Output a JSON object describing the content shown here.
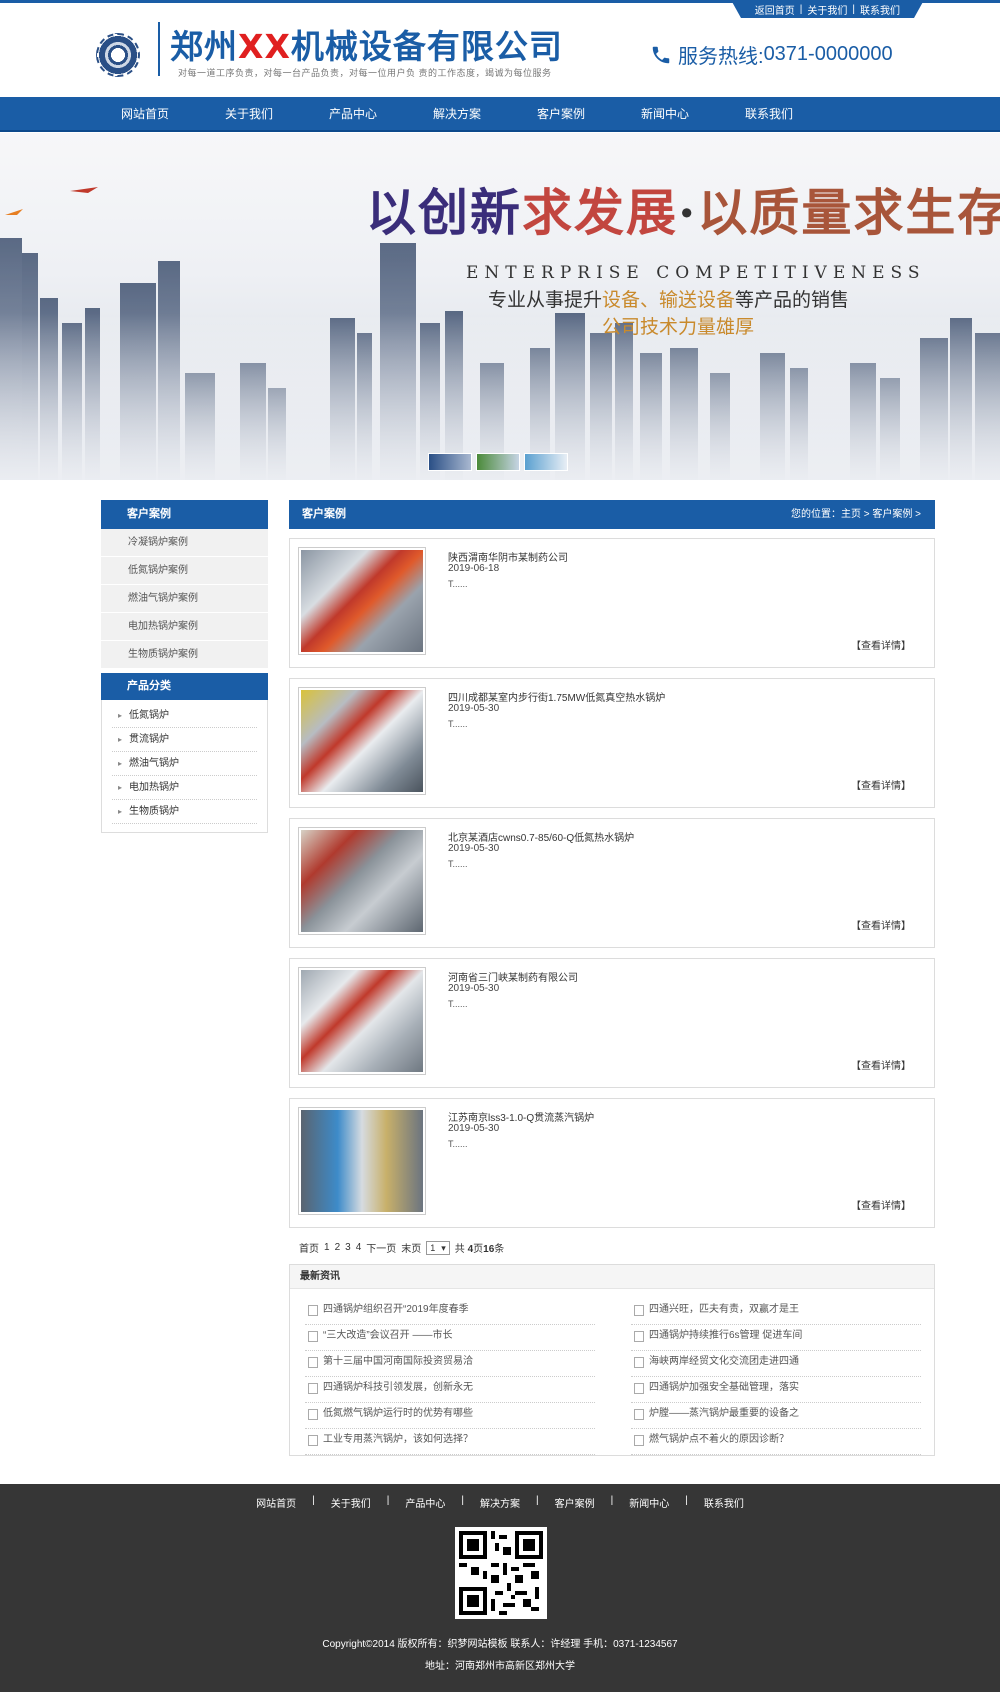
{
  "header": {
    "top_links": [
      "返回首页",
      "关于我们",
      "联系我们"
    ],
    "company_prefix": "郑州",
    "company_xx": "XX",
    "company_suffix": "机械设备有限公司",
    "slogan": "对每一道工序负责，对每一台产品负责，对每一位用户负 责的工作态度，竭诚为每位服务",
    "hotline_label": "服务热线:",
    "hotline_number": "0371-0000000"
  },
  "nav": [
    "网站首页",
    "关于我们",
    "产品中心",
    "解决方案",
    "客户案例",
    "新闻中心",
    "联系我们"
  ],
  "banner": {
    "title_part1": "以创新",
    "title_part2": "求发展",
    "title_dot": "·",
    "title_part3": "以质量求生存",
    "english": "ENTERPRISE COMPETITIVENESS",
    "sub1_a": "专业从事提升",
    "sub1_b": "设备、输送设备",
    "sub1_c": "等产品的销售",
    "sub2": "公司技术力量雄厚"
  },
  "sidebar": {
    "cases_title": "客户案例",
    "cases": [
      "冷凝锅炉案例",
      "低氮锅炉案例",
      "燃油气锅炉案例",
      "电加热锅炉案例",
      "生物质锅炉案例"
    ],
    "products_title": "产品分类",
    "products": [
      "低氮锅炉",
      "贯流锅炉",
      "燃油气锅炉",
      "电加热锅炉",
      "生物质锅炉"
    ]
  },
  "main": {
    "title": "客户案例",
    "breadcrumb": "您的位置：主页 > 客户案例 >",
    "more_label": "【查看详情】",
    "cases": [
      {
        "title": "陕西渭南华阴市某制药公司",
        "date": "2019-06-18",
        "desc": "T......"
      },
      {
        "title": "四川成都某室内步行街1.75MW低氮真空热水锅炉",
        "date": "2019-05-30",
        "desc": "T......"
      },
      {
        "title": "北京某酒店cwns0.7-85/60-Q低氮热水锅炉",
        "date": "2019-05-30",
        "desc": "T......"
      },
      {
        "title": "河南省三门峡某制药有限公司",
        "date": "2019-05-30",
        "desc": "T......"
      },
      {
        "title": "江苏南京lss3-1.0-Q贯流蒸汽锅炉",
        "date": "2019-05-30",
        "desc": "T......"
      }
    ]
  },
  "pager": {
    "first": "首页",
    "pages": [
      "1",
      "2",
      "3",
      "4"
    ],
    "next": "下一页",
    "last": "末页",
    "select_value": "1",
    "total_prefix": "共",
    "total_pages": "4",
    "pages_unit": "页",
    "total_items": "16",
    "items_unit": "条"
  },
  "news": {
    "title": "最新资讯",
    "left": [
      "四通锅炉组织召开“2019年度春季",
      "“三大改造”会议召开 ——市长",
      "第十三届中国河南国际投资贸易洽",
      "四通锅炉科技引领发展，创新永无",
      "低氮燃气锅炉运行时的优势有哪些",
      "工业专用蒸汽锅炉，该如何选择？"
    ],
    "right": [
      "四通兴旺，匹夫有责，双赢才是王",
      "四通锅炉持续推行6s管理 促进车间",
      "海峡两岸经贸文化交流团走进四通",
      "四通锅炉加强安全基础管理，落实",
      "炉膛——蒸汽锅炉最重要的设备之",
      "燃气锅炉点不着火的原因诊断？"
    ]
  },
  "footer": {
    "nav": [
      "网站首页",
      "关于我们",
      "产品中心",
      "解决方案",
      "客户案例",
      "新闻中心",
      "联系我们"
    ],
    "copyright": "Copyright©2014 版权所有：织梦网站模板   联系人：许经理   手机：0371-1234567",
    "address": "地址：河南郑州市高新区郑州大学"
  },
  "colors": {
    "brand_blue": "#1a5da6",
    "brand_red": "#e02020",
    "footer_bg": "#363636"
  }
}
